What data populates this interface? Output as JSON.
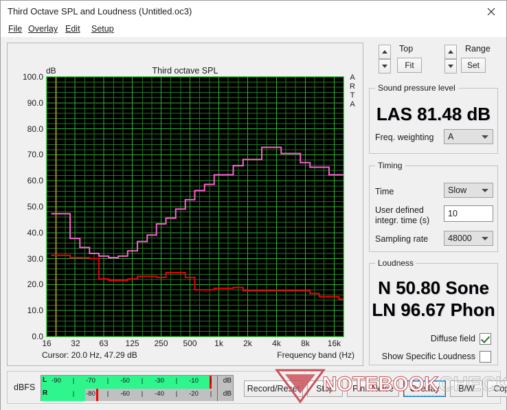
{
  "window": {
    "title": "Third Octave SPL and Loudness (Untitled.oc3)",
    "close_icon": "close-icon"
  },
  "menu": {
    "items": [
      {
        "label": "File",
        "accel": "F"
      },
      {
        "label": "Overlay",
        "accel": "O"
      },
      {
        "label": "Edit",
        "accel": "E"
      },
      {
        "label": "Setup",
        "accel": "S"
      }
    ]
  },
  "graph": {
    "title": "Third octave SPL",
    "y_axis_unit": "dB",
    "watermark_side": "ARTA",
    "cursor_text": "Cursor:   20.0 Hz, 47.29 dB",
    "x_axis_label": "Frequency band (Hz)"
  },
  "chart_data": {
    "type": "line",
    "title": "Third octave SPL",
    "xlabel": "Frequency band (Hz)",
    "ylabel": "dB",
    "ylim": [
      0,
      100
    ],
    "ytick_labels": [
      "100.0",
      "90.0",
      "80.0",
      "70.0",
      "60.0",
      "50.0",
      "40.0",
      "30.0",
      "20.0",
      "10.0",
      "0.0"
    ],
    "ytick_values": [
      100,
      90,
      80,
      70,
      60,
      50,
      40,
      30,
      20,
      10,
      0
    ],
    "xtick_labels": [
      "16",
      "32",
      "63",
      "125",
      "250",
      "500",
      "1k",
      "2k",
      "4k",
      "8k",
      "16k"
    ],
    "xtick_values": [
      16,
      32,
      63,
      125,
      250,
      500,
      1000,
      2000,
      4000,
      8000,
      16000
    ],
    "grid": true,
    "grid_color": "#1f7a1f",
    "grid_major_color": "#31b531",
    "plot_bg": "#000000",
    "cursor_line_color": "#9e8b1e",
    "cursor_frequency_hz": 20.0,
    "cursor_level_db": 47.29,
    "legend": [],
    "categories": [
      20,
      25,
      31.5,
      40,
      50,
      63,
      80,
      100,
      125,
      160,
      200,
      250,
      315,
      400,
      500,
      630,
      800,
      1000,
      1250,
      1600,
      2000,
      2500,
      3150,
      4000,
      5000,
      6300,
      8000,
      10000,
      12500,
      16000,
      20000
    ],
    "series": [
      {
        "name": "Third octave SPL",
        "color": "#ff5fd2",
        "values": [
          47.3,
          47.3,
          37.8,
          34.3,
          32.0,
          31.0,
          30.4,
          31.0,
          33.0,
          36.6,
          39.1,
          43.4,
          45.6,
          49.1,
          52.7,
          56.2,
          58.6,
          62.3,
          62.3,
          65.8,
          68.2,
          68.2,
          72.9,
          72.9,
          70.5,
          70.5,
          67.0,
          65.2,
          65.2,
          62.3,
          62.3
        ]
      },
      {
        "name": "Overlay",
        "color": "#ee0000",
        "values": [
          31.3,
          31.3,
          30.4,
          30.4,
          30.1,
          22.2,
          21.6,
          21.6,
          22.2,
          23.2,
          23.2,
          22.8,
          24.6,
          24.6,
          22.8,
          18.0,
          18.0,
          18.6,
          18.6,
          18.9,
          17.6,
          17.6,
          17.6,
          17.6,
          17.6,
          17.6,
          17.6,
          16.6,
          15.3,
          15.3,
          14.4
        ]
      }
    ]
  },
  "controls": {
    "top": {
      "label": "Top",
      "button": "Fit"
    },
    "range": {
      "label": "Range",
      "button": "Set"
    },
    "spinner_up_icon": "chevron-up-icon",
    "spinner_down_icon": "chevron-down-icon"
  },
  "spl_group": {
    "title": "Sound pressure level",
    "readout": "LAS 81.48 dB",
    "weighting_label": "Freq. weighting",
    "weighting_value": "A"
  },
  "timing_group": {
    "title": "Timing",
    "time_label": "Time",
    "time_value": "Slow",
    "integration_label_line1": "User defined",
    "integration_label_line2": "integr. time (s)",
    "integration_value": "10",
    "sampling_label": "Sampling rate",
    "sampling_value": "48000"
  },
  "loudness_group": {
    "title": "Loudness",
    "readout_n": "N 50.80 Sone",
    "readout_ln": "LN 96.67 Phon",
    "diffuse_field_label": "Diffuse field",
    "diffuse_field_checked": true,
    "specific_loudness_label": "Show Specific Loudness",
    "specific_loudness_checked": false
  },
  "meter": {
    "label": "dBFS",
    "left_channel": "L",
    "right_channel": "R",
    "unit_left": "dB",
    "unit_right": "dB",
    "ticks": [
      "-90",
      "-70",
      "-50",
      "-30",
      "-10"
    ],
    "ticks_lower": [
      "-80",
      "-60",
      "-40",
      "-20"
    ],
    "left_fill_pct": 95.5,
    "right_fill_pct": 25.0,
    "left_peak_pct": 95.5,
    "right_peak_pct": 31.0,
    "fill_color": "#2ff58d",
    "peak_color": "#ff0000"
  },
  "buttons": [
    {
      "label": "Record/Reset",
      "focused": false
    },
    {
      "label": "Stop",
      "focused": false
    },
    {
      "label": "Pink Noise",
      "focused": false
    },
    {
      "label": "Overlay",
      "focused": true
    },
    {
      "label": "B/W",
      "focused": false
    },
    {
      "label": "Copy",
      "focused": false
    }
  ],
  "watermark": {
    "part1": "NOTEBOOK",
    "part2": "CHECK"
  }
}
